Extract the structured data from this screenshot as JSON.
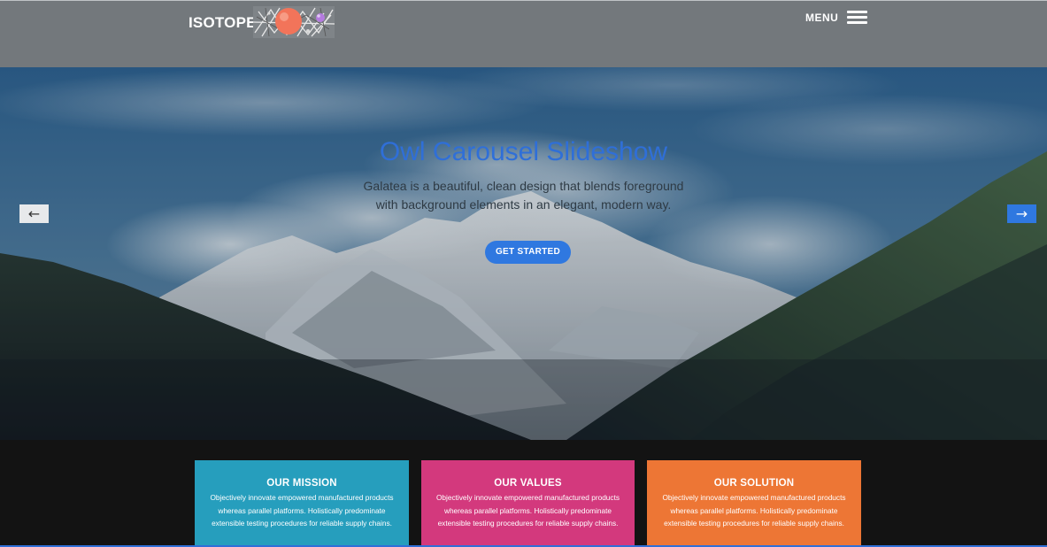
{
  "header": {
    "logo_text": "ISOTOPE",
    "logo_icon": "atom-molecule-icon",
    "menu_label": "MENU",
    "menu_icon": "hamburger-icon"
  },
  "hero": {
    "title": "Owl Carousel Slideshow",
    "subtitle_lines": [
      "Galatea is a beautiful, clean design that blends foreground",
      "with background elements in an elegant, modern way."
    ],
    "cta_label": "GET STARTED",
    "prev_arrow": "←",
    "next_arrow": "→",
    "background_image": "snowy-mountain-valley"
  },
  "features": [
    {
      "title": "OUR MISSION",
      "text": "Objectively innovate empowered manufactured products whereas parallel platforms. Holistically predominate extensible testing procedures for reliable supply chains.",
      "color": "#269ebd"
    },
    {
      "title": "OUR VALUES",
      "text": "Objectively innovate empowered manufactured products whereas parallel platforms. Holistically predominate extensible testing procedures for reliable supply chains.",
      "color": "#d3397d"
    },
    {
      "title": "OUR SOLUTION",
      "text": "Objectively innovate empowered manufactured products whereas parallel platforms. Holistically predominate extensible testing procedures for reliable supply chains.",
      "color": "#ed7635"
    }
  ],
  "colors": {
    "header_bg": "#73787c",
    "accent_blue": "#2f78e0",
    "page_bg": "#131313"
  }
}
